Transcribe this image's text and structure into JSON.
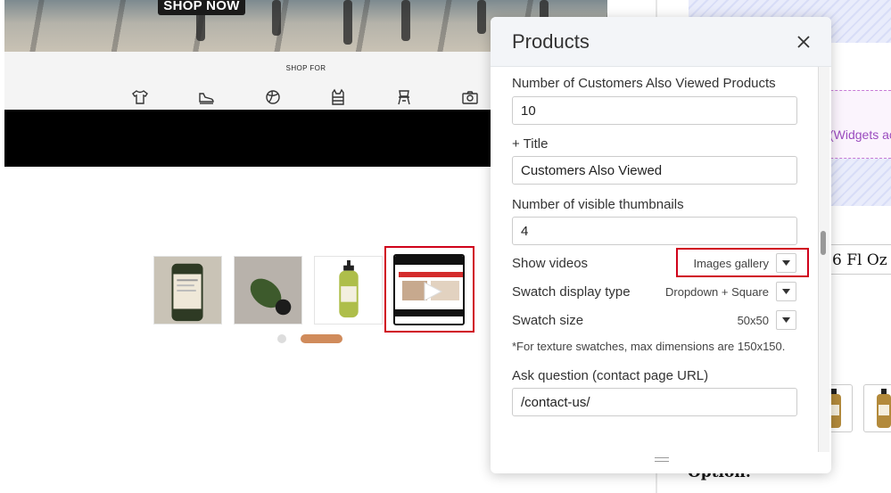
{
  "preview": {
    "hero_button": "SHOP NOW",
    "shop_for_label": "SHOP FOR",
    "category_icons": [
      "shirt-icon",
      "shoe-icon",
      "ball-icon",
      "vest-icon",
      "chair-icon",
      "camera-icon"
    ]
  },
  "panel_bg": {
    "widget_text": "(Widgets ac",
    "size_text": "6 Fl Oz",
    "option_text": "Option:"
  },
  "modal": {
    "title": "Products",
    "fields": {
      "also_viewed_count_label": "Number of Customers Also Viewed Products",
      "also_viewed_count_value": "10",
      "title_label": "+ Title",
      "title_value": "Customers Also Viewed",
      "thumbnails_label": "Number of visible thumbnails",
      "thumbnails_value": "4",
      "show_videos_label": "Show videos",
      "show_videos_value": "Images gallery",
      "swatch_type_label": "Swatch display type",
      "swatch_type_value": "Dropdown + Square",
      "swatch_size_label": "Swatch size",
      "swatch_size_value": "50x50",
      "texture_note": "*For texture swatches, max dimensions are 150x150.",
      "ask_question_label": "Ask question (contact page URL)",
      "ask_question_value": "/contact-us/"
    }
  },
  "colors": {
    "highlight": "#d0021b",
    "dot_active": "#d08b5b",
    "widget_purple": "#9b4cbf"
  }
}
